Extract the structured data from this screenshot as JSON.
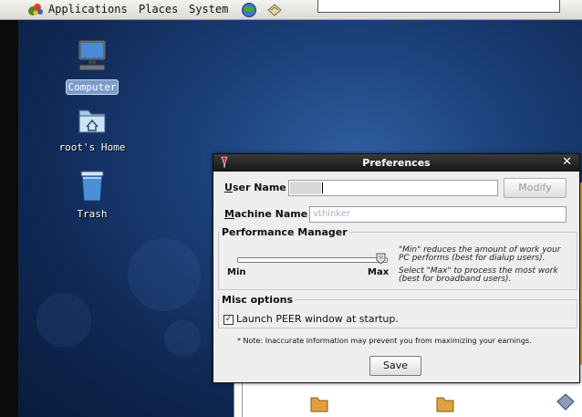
{
  "top_panel": {
    "menus": [
      "Applications",
      "Places",
      "System"
    ]
  },
  "desktop": {
    "icons": [
      {
        "label": "Computer"
      },
      {
        "label": "root's Home"
      },
      {
        "label": "Trash"
      }
    ]
  },
  "dialog": {
    "title": "Preferences",
    "user_name_label_u": "U",
    "user_name_label_rest": "ser Name",
    "user_name_value": "",
    "modify_label": "Modify",
    "machine_name_label_u": "M",
    "machine_name_label_rest": "achine Name",
    "machine_name_value": "vthinker",
    "performance": {
      "title": "Performance Manager",
      "min_label": "Min",
      "max_label": "Max",
      "slider_level": 1.0,
      "hint_min_1": "\"Min\" reduces the amount of work your",
      "hint_min_2": "PC performs (best for dialup users).",
      "hint_max_1": "Select \"Max\" to process the most work",
      "hint_max_2": "(best for broadband users)."
    },
    "misc": {
      "title": "Misc options",
      "launch_label": "Launch PEER window  at startup.",
      "launch_checked": true
    },
    "note": "* Note: Inaccurate information may prevent you from maximizing your earnings.",
    "save_label": "Save"
  }
}
